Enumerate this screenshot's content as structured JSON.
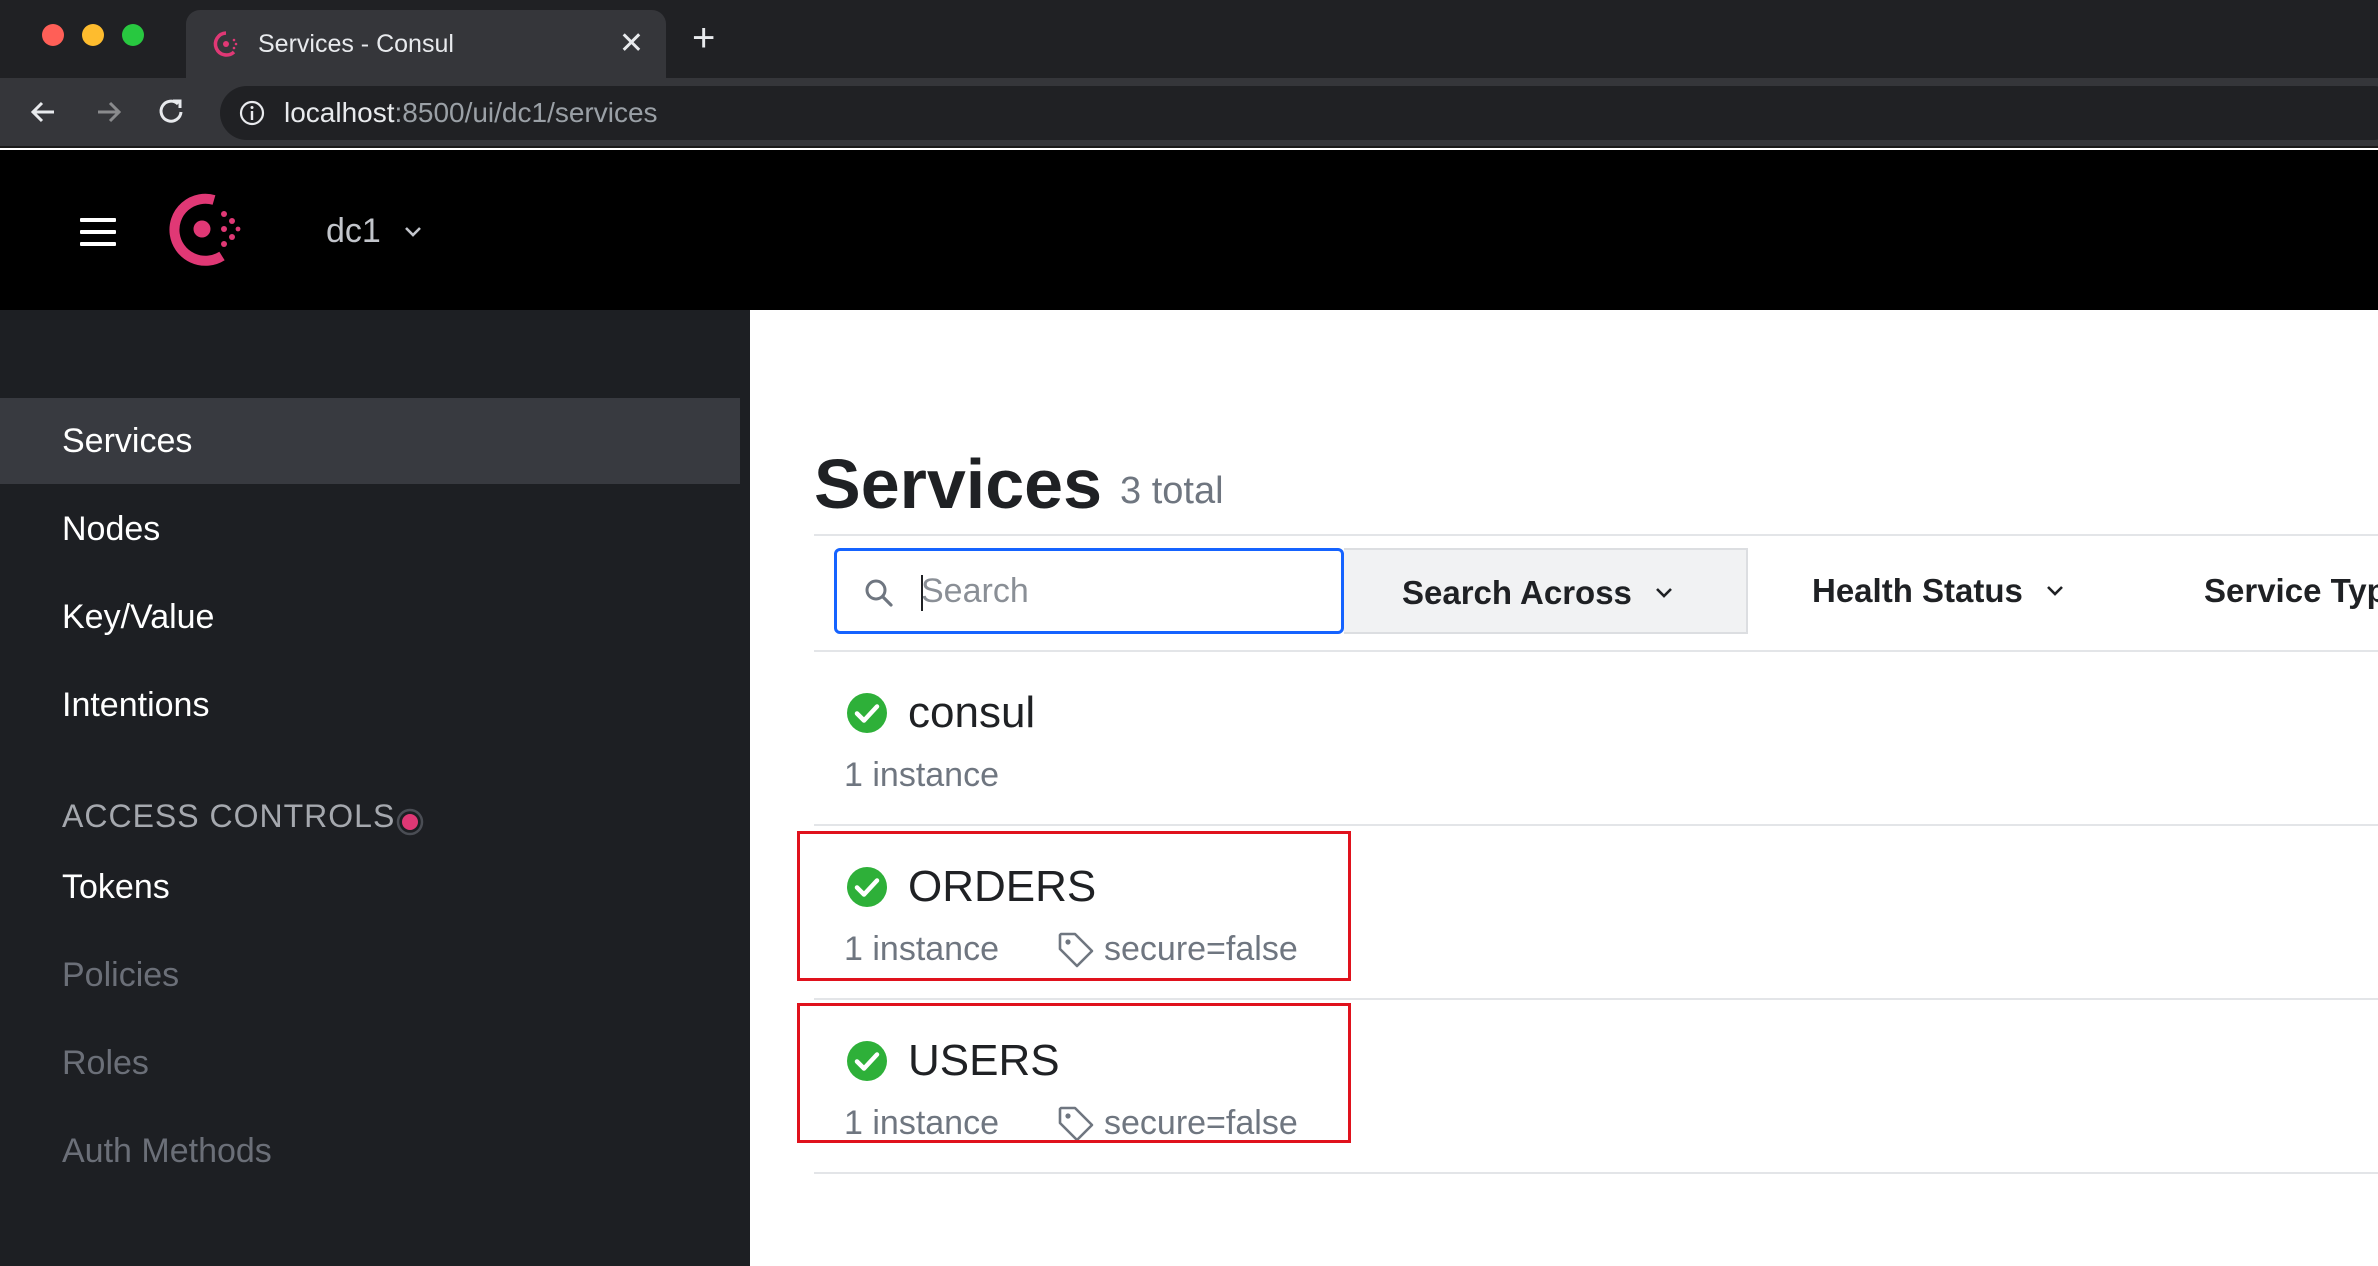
{
  "browser": {
    "tab_title": "Services - Consul",
    "tab_close": "✕",
    "new_tab": "+",
    "url_host": "localhost",
    "url_path": ":8500/ui/dc1/services"
  },
  "header": {
    "datacenter": "dc1"
  },
  "sidebar": {
    "items": [
      {
        "label": "Services",
        "active": true
      },
      {
        "label": "Nodes"
      },
      {
        "label": "Key/Value"
      },
      {
        "label": "Intentions"
      }
    ],
    "section_label": "ACCESS CONTROLS",
    "acl_items": [
      {
        "label": "Tokens",
        "disabled": false
      },
      {
        "label": "Policies",
        "disabled": true
      },
      {
        "label": "Roles",
        "disabled": true
      },
      {
        "label": "Auth Methods",
        "disabled": true
      }
    ]
  },
  "main": {
    "title": "Services",
    "count": "3 total",
    "search_placeholder": "Search",
    "filters": {
      "search_across": "Search Across",
      "health_status": "Health Status",
      "service_type": "Service Typ"
    },
    "services": [
      {
        "name": "consul",
        "instances": "1 instance",
        "tag": ""
      },
      {
        "name": "ORDERS",
        "instances": "1 instance",
        "tag": "secure=false"
      },
      {
        "name": "USERS",
        "instances": "1 instance",
        "tag": "secure=false"
      }
    ]
  },
  "colors": {
    "consul_brand": "#e03875",
    "passing": "#2eb039",
    "highlight": "#e0121d",
    "focus_blue": "#1563ff"
  },
  "icons": [
    "consul-logo-icon",
    "hamburger-icon",
    "chevron-down-icon",
    "search-icon",
    "check-circle-icon",
    "tag-icon",
    "info-icon",
    "back-arrow-icon",
    "forward-arrow-icon",
    "reload-icon",
    "close-icon"
  ]
}
